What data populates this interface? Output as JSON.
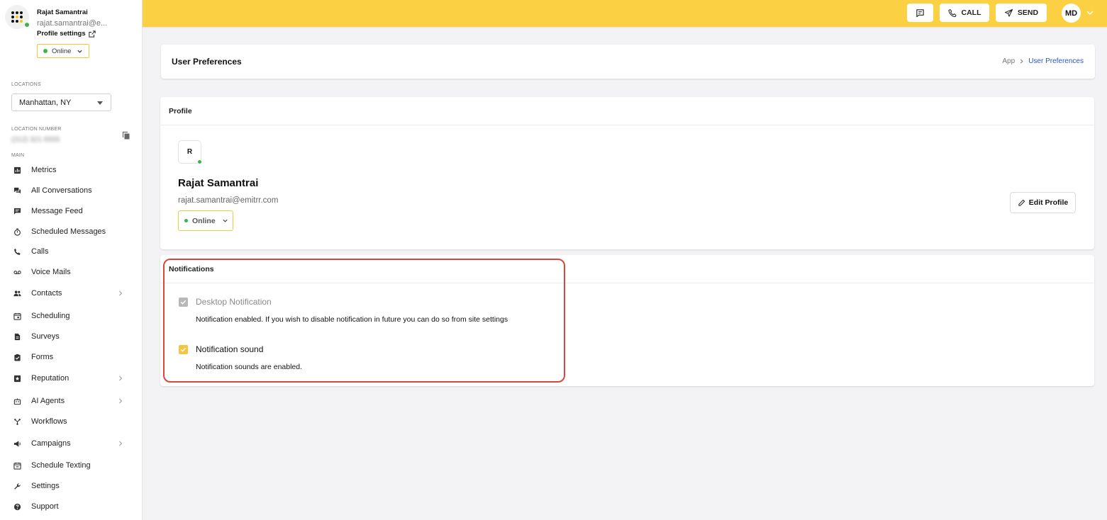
{
  "user": {
    "name": "Rajat Samantrai",
    "email_truncated": "rajat.samantrai@e...",
    "profile_settings": "Profile settings",
    "status": "Online"
  },
  "sidebar": {
    "locations_label": "LOCATIONS",
    "location_value": "Manhattan, NY",
    "location_number_label": "LOCATION NUMBER",
    "location_number_value": "(212) 321-5555",
    "main_label": "MAIN",
    "items": [
      {
        "label": "Metrics",
        "icon": "bar-chart-icon",
        "chevron": false
      },
      {
        "label": "All Conversations",
        "icon": "chat-bubbles-icon",
        "chevron": false
      },
      {
        "label": "Message Feed",
        "icon": "message-icon",
        "chevron": false
      },
      {
        "label": "Scheduled Messages",
        "icon": "timer-icon",
        "chevron": false
      },
      {
        "label": "Calls",
        "icon": "phone-icon",
        "chevron": false
      },
      {
        "label": "Voice Mails",
        "icon": "voicemail-icon",
        "chevron": false
      },
      {
        "label": "Contacts",
        "icon": "people-icon",
        "chevron": true
      },
      {
        "label": "Scheduling",
        "icon": "calendar-icon",
        "chevron": false
      },
      {
        "label": "Surveys",
        "icon": "document-icon",
        "chevron": false
      },
      {
        "label": "Forms",
        "icon": "clipboard-check-icon",
        "chevron": false
      },
      {
        "label": "Reputation",
        "icon": "star-box-icon",
        "chevron": true
      },
      {
        "label": "AI Agents",
        "icon": "robot-icon",
        "chevron": true
      },
      {
        "label": "Workflows",
        "icon": "workflow-icon",
        "chevron": false
      },
      {
        "label": "Campaigns",
        "icon": "megaphone-icon",
        "chevron": true
      },
      {
        "label": "Schedule Texting",
        "icon": "calendar-clock-icon",
        "chevron": false
      },
      {
        "label": "Settings",
        "icon": "wrench-icon",
        "chevron": false
      },
      {
        "label": "Support",
        "icon": "help-circle-icon",
        "chevron": false
      }
    ]
  },
  "topbar": {
    "call_label": "CALL",
    "send_label": "SEND",
    "avatar_initials": "MD",
    "bg_color": "#fbd042"
  },
  "header": {
    "title": "User Preferences",
    "breadcrumb": [
      "App",
      "User Preferences"
    ]
  },
  "profile": {
    "section_title": "Profile",
    "avatar_initial": "R",
    "name": "Rajat Samantrai",
    "email": "rajat.samantrai@emitrr.com",
    "status": "Online",
    "edit_label": "Edit Profile"
  },
  "notifications": {
    "section_title": "Notifications",
    "items": [
      {
        "title": "Desktop Notification",
        "checked": true,
        "disabled": true,
        "desc": "Notification enabled. If you wish to disable notification in future you can do so from site settings"
      },
      {
        "title": "Notification sound",
        "checked": true,
        "disabled": false,
        "desc": "Notification sounds are enabled."
      }
    ]
  },
  "colors": {
    "accent": "#fbd042",
    "online": "#3bb54a",
    "highlight": "#d9473a",
    "link": "#2c55c8"
  }
}
